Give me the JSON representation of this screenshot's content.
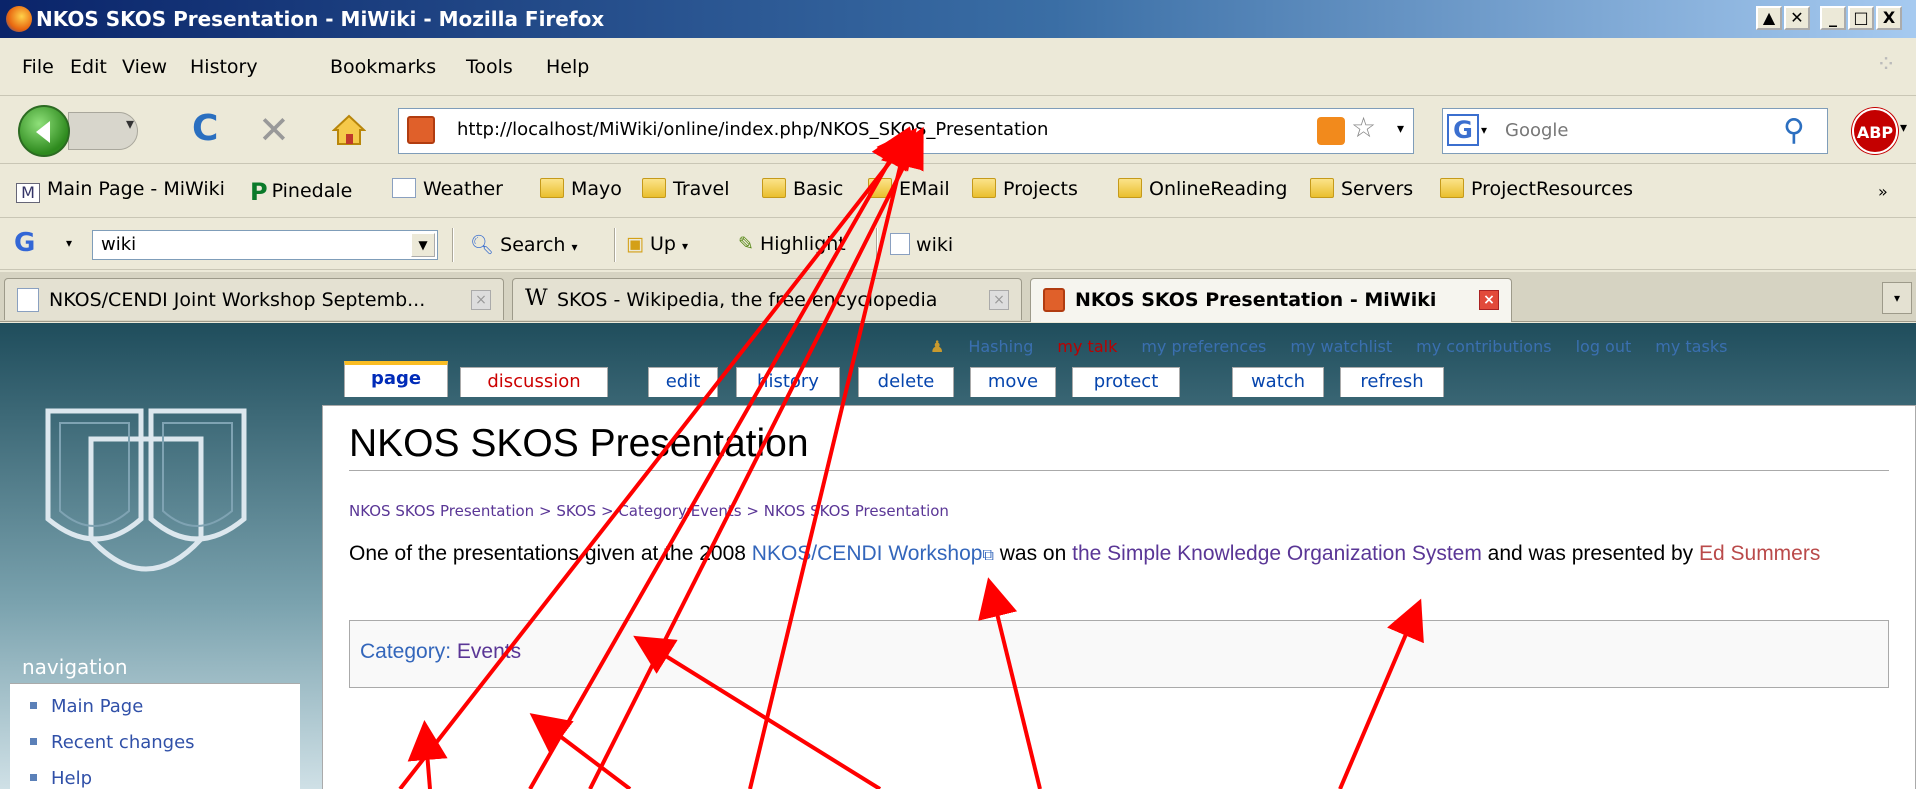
{
  "window": {
    "title": "NKOS SKOS Presentation - MiWiki - Mozilla Firefox"
  },
  "menu": [
    "File",
    "Edit",
    "View",
    "History",
    "Bookmarks",
    "Tools",
    "Help"
  ],
  "nav": {
    "url": "http://localhost/MiWiki/online/index.php/NKOS_SKOS_Presentation",
    "search_placeholder": "Google",
    "abp_label": "ABP"
  },
  "bookmarks": [
    "Main Page - MiWiki",
    "Pinedale",
    "Weather",
    "Mayo",
    "Travel",
    "Basic",
    "EMail",
    "Projects",
    "OnlineReading",
    "Servers",
    "ProjectResources"
  ],
  "google_toolbar": {
    "query": "wiki",
    "search": "Search",
    "up": "Up",
    "highlight": "Highlight",
    "word": "wiki"
  },
  "tabs": [
    {
      "label": "NKOS/CENDI Joint Workshop Septemb...",
      "active": false
    },
    {
      "label": "SKOS - Wikipedia, the free encyclopedia",
      "active": false
    },
    {
      "label": "NKOS SKOS Presentation - MiWiki",
      "active": true
    }
  ],
  "wiki": {
    "user_tools": [
      "Hashing",
      "my talk",
      "my preferences",
      "my watchlist",
      "my contributions",
      "log out",
      "my tasks"
    ],
    "page_tabs": [
      "page",
      "discussion",
      "edit",
      "history",
      "delete",
      "move",
      "protect",
      "watch",
      "refresh"
    ],
    "title": "NKOS SKOS Presentation",
    "breadcrumbs": [
      "NKOS SKOS Presentation",
      "SKOS",
      "Category:Events",
      "NKOS SKOS Presentation"
    ],
    "breadcrumb_sep": ">",
    "para": {
      "text1": "One of the presentations given at the 2008 ",
      "link1": "NKOS/CENDI Workshop",
      "text2": " was on ",
      "link2": "the Simple Knowledge Organization System",
      "text3": " and was presented by ",
      "link3": "Ed Summers"
    },
    "category_label": "Category",
    "category_value": "Events",
    "navigation_title": "navigation",
    "navigation": [
      "Main Page",
      "Recent changes",
      "Help"
    ]
  },
  "colors": {
    "annotation": "#ff0000",
    "titlebar": "#0a246a",
    "wiki_link": "#3366bb"
  }
}
